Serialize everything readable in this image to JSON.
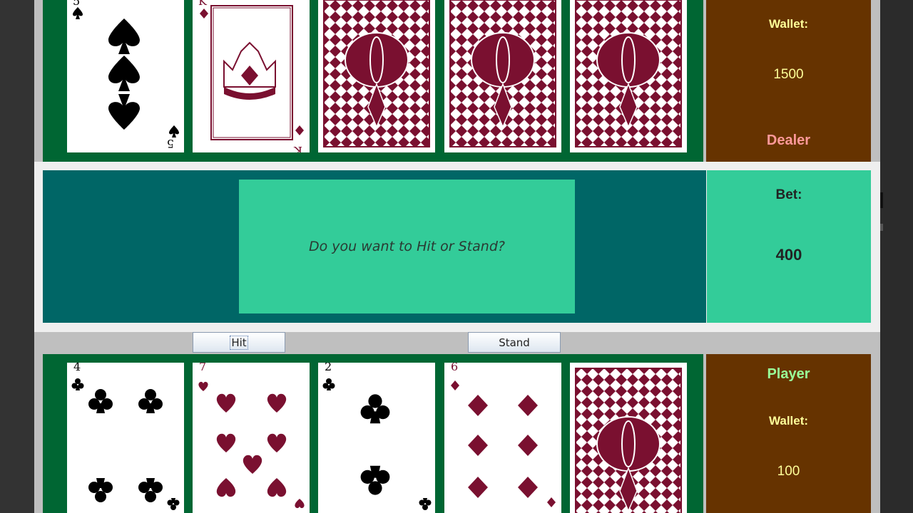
{
  "dealer": {
    "name": "Dealer",
    "wallet_label": "Wallet:",
    "wallet": "1500",
    "cards": [
      {
        "face": "up",
        "rank": "5",
        "suit": "spades"
      },
      {
        "face": "up",
        "rank": "K",
        "suit": "diamonds"
      },
      {
        "face": "down"
      },
      {
        "face": "down"
      },
      {
        "face": "down"
      }
    ]
  },
  "message": "Do you want to Hit or Stand?",
  "bet": {
    "label": "Bet:",
    "value": "400"
  },
  "controls": {
    "hit_label": "Hit",
    "stand_label": "Stand"
  },
  "player": {
    "name": "Player",
    "wallet_label": "Wallet:",
    "wallet": "100",
    "cards": [
      {
        "face": "up",
        "rank": "4",
        "suit": "clubs"
      },
      {
        "face": "up",
        "rank": "7",
        "suit": "hearts"
      },
      {
        "face": "up",
        "rank": "2",
        "suit": "clubs"
      },
      {
        "face": "up",
        "rank": "6",
        "suit": "diamonds"
      },
      {
        "face": "down"
      }
    ]
  },
  "colors": {
    "table_felt": "#006633",
    "panel_brown": "#663300",
    "message_area": "#006666",
    "message_box": "#33cc99",
    "card_red": "#7a1030",
    "card_black": "#000000"
  }
}
